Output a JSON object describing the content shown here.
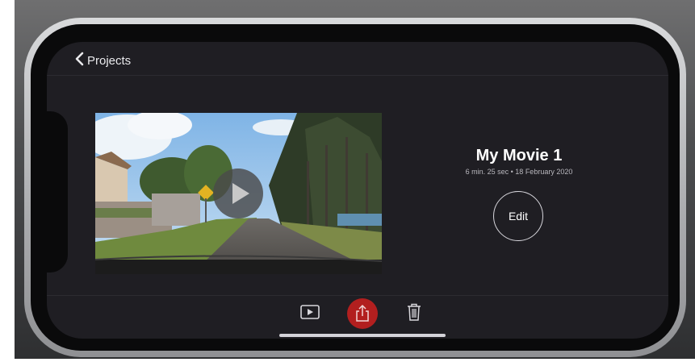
{
  "nav": {
    "back_label": "Projects"
  },
  "project": {
    "title": "My Movie 1",
    "meta": "6 min. 25 sec • 18 February 2020",
    "edit_label": "Edit"
  },
  "icons": {
    "back": "chevron-left-icon",
    "play": "play-icon",
    "preview": "play-rectangle-icon",
    "share": "share-icon",
    "delete": "trash-icon"
  },
  "colors": {
    "screen_bg": "#1f1e23",
    "share_accent": "#b21f1f",
    "text_primary": "#ffffff",
    "text_secondary": "#b9b8be"
  }
}
